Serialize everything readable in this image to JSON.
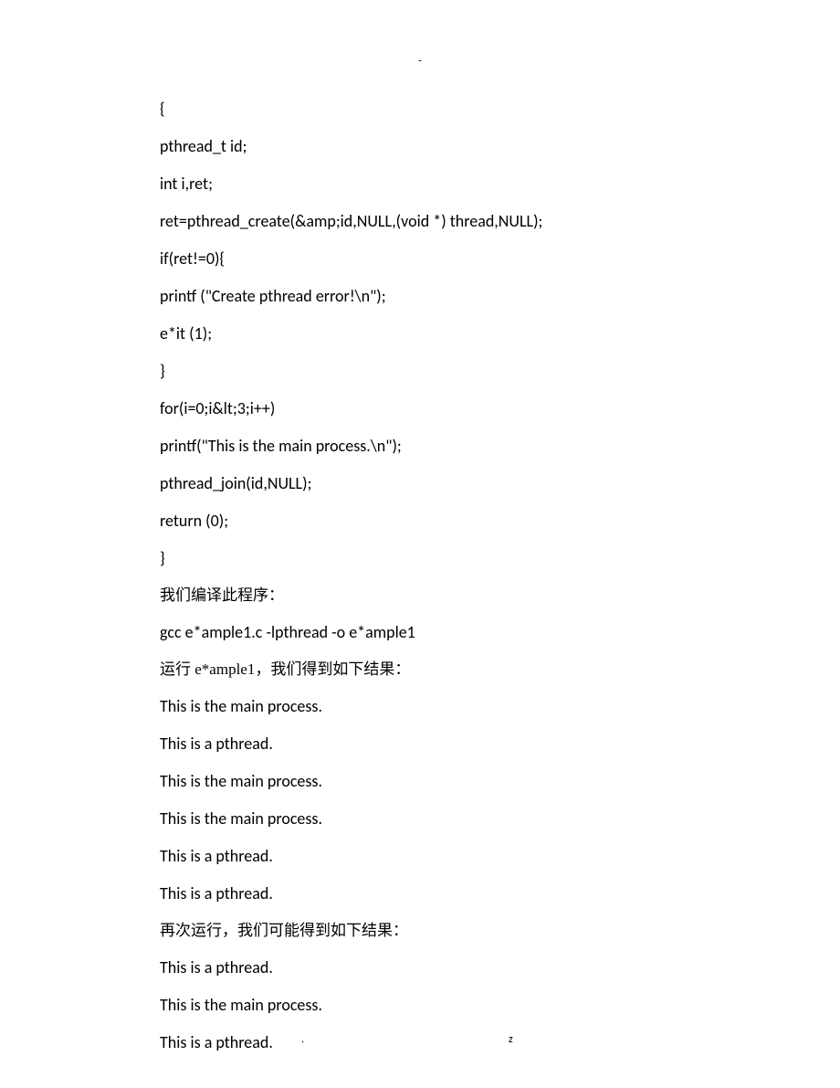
{
  "topMark": "-",
  "lines": [
    {
      "text": "{",
      "cjk": false
    },
    {
      "text": "pthread_t id;",
      "cjk": false
    },
    {
      "text": "int i,ret;",
      "cjk": false
    },
    {
      "text": "ret=pthread_create(&amp;id,NULL,(void *) thread,NULL);",
      "cjk": false
    },
    {
      "text": "if(ret!=0){",
      "cjk": false
    },
    {
      "text": "printf (\"Create pthread error!\\n\");",
      "cjk": false
    },
    {
      "text": "e*it (1);",
      "cjk": false
    },
    {
      "text": "}",
      "cjk": false
    },
    {
      "text": "for(i=0;i&lt;3;i++)",
      "cjk": false
    },
    {
      "text": "printf(\"This is the main process.\\n\");",
      "cjk": false
    },
    {
      "text": "pthread_join(id,NULL);",
      "cjk": false
    },
    {
      "text": "return (0);",
      "cjk": false
    },
    {
      "text": "}",
      "cjk": false
    },
    {
      "text": "我们编译此程序：",
      "cjk": true
    },
    {
      "text": "gcc e*ample1.c -lpthread -o e*ample1",
      "cjk": false
    },
    {
      "text": "运行 e*ample1，我们得到如下结果：",
      "cjk": true
    },
    {
      "text": "This is the main process.",
      "cjk": false
    },
    {
      "text": "This is a pthread.",
      "cjk": false
    },
    {
      "text": "This is the main process.",
      "cjk": false
    },
    {
      "text": "This is the main process.",
      "cjk": false
    },
    {
      "text": "This is a pthread.",
      "cjk": false
    },
    {
      "text": "This is a pthread.",
      "cjk": false
    },
    {
      "text": "再次运行，我们可能得到如下结果：",
      "cjk": true
    },
    {
      "text": "This is a pthread.",
      "cjk": false
    },
    {
      "text": "This is the main process.",
      "cjk": false
    },
    {
      "text": "This is a pthread.",
      "cjk": false
    }
  ],
  "footer": {
    "dot": ".",
    "z": "z"
  }
}
